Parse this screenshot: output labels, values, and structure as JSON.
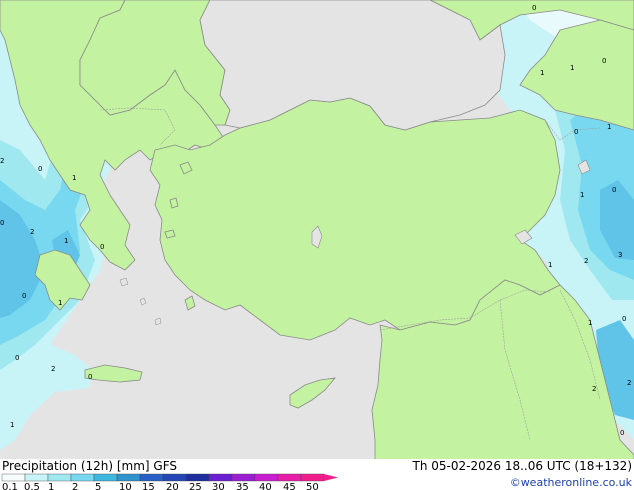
{
  "map": {
    "title": "Precipitation (12h) [mm] GFS",
    "valid_time": "Th 05-02-2026 18..06 UTC (18+132)",
    "credit": "©weatheronline.co.uk",
    "colors": {
      "sea": "#e4e4e4",
      "land": "#c3f2a0",
      "coast": "#8a8a8a",
      "border": "#a0a0a0"
    },
    "legend": {
      "labels": [
        "0.1",
        "0.5",
        "1",
        "2",
        "5",
        "10",
        "15",
        "20",
        "25",
        "30",
        "35",
        "40",
        "45",
        "50"
      ],
      "colors": [
        "#f5fdfd",
        "#c8f4f7",
        "#9fe8f0",
        "#78d8ef",
        "#3fb8e0",
        "#2f93cc",
        "#2860c8",
        "#2346b4",
        "#1e2fa0",
        "#6a1fd0",
        "#9b1ed2",
        "#c81ed2",
        "#e61ea8",
        "#f01e8a"
      ]
    },
    "contour_labels": [
      {
        "text": "0"
      },
      {
        "text": "1"
      },
      {
        "text": "1"
      },
      {
        "text": "0"
      },
      {
        "text": "1"
      },
      {
        "text": "0"
      },
      {
        "text": "1"
      },
      {
        "text": "0"
      },
      {
        "text": "2"
      },
      {
        "text": "1"
      },
      {
        "text": "0"
      },
      {
        "text": "2"
      },
      {
        "text": "1"
      },
      {
        "text": "0"
      },
      {
        "text": "0"
      },
      {
        "text": "1"
      },
      {
        "text": "0"
      },
      {
        "text": "2"
      },
      {
        "text": "0"
      },
      {
        "text": "1"
      },
      {
        "text": "2"
      },
      {
        "text": "3"
      },
      {
        "text": "1"
      },
      {
        "text": "0"
      },
      {
        "text": "2"
      },
      {
        "text": "2"
      },
      {
        "text": "1"
      },
      {
        "text": "0"
      },
      {
        "text": "0"
      }
    ]
  }
}
